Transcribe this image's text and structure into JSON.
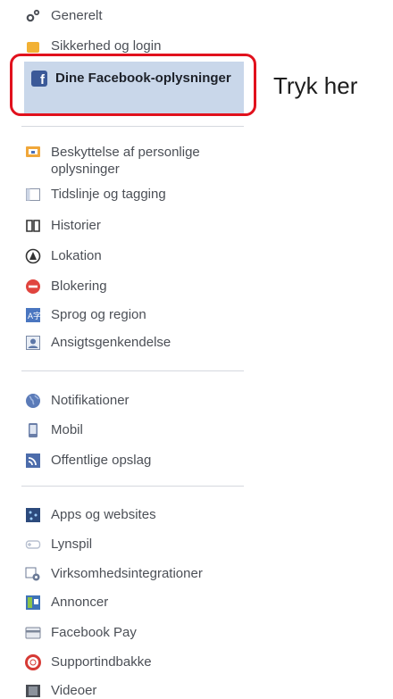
{
  "menu": {
    "top_items": [
      {
        "label": "Generelt",
        "icon": "gear-icon"
      },
      {
        "label": "Sikkerhed og login",
        "icon": "shield-icon"
      }
    ],
    "selected": {
      "label": "Dine Facebook-oplysninger",
      "icon": "facebook-icon"
    },
    "group_privacy": [
      {
        "label": "Beskyttelse af personlige oplysninger",
        "icon": "privacy-lock-icon"
      },
      {
        "label": "Tidslinje og tagging",
        "icon": "timeline-icon"
      },
      {
        "label": "Historier",
        "icon": "book-icon"
      },
      {
        "label": "Lokation",
        "icon": "location-icon"
      },
      {
        "label": "Blokering",
        "icon": "block-icon"
      },
      {
        "label": "Sprog og region",
        "icon": "language-icon"
      },
      {
        "label": "Ansigtsgenkendelse",
        "icon": "face-recognition-icon"
      }
    ],
    "group_notifications": [
      {
        "label": "Notifikationer",
        "icon": "globe-icon"
      },
      {
        "label": "Mobil",
        "icon": "mobile-icon"
      },
      {
        "label": "Offentlige opslag",
        "icon": "rss-icon"
      }
    ],
    "group_apps": [
      {
        "label": "Apps og websites",
        "icon": "apps-icon"
      },
      {
        "label": "Lynspil",
        "icon": "gamepad-icon"
      },
      {
        "label": "Virksomhedsintegrationer",
        "icon": "business-integration-icon"
      },
      {
        "label": "Annoncer",
        "icon": "ads-icon"
      },
      {
        "label": "Facebook Pay",
        "icon": "credit-card-icon"
      },
      {
        "label": "Supportindbakke",
        "icon": "lifebuoy-icon"
      },
      {
        "label": "Videoer",
        "icon": "video-icon"
      }
    ]
  },
  "annotation": {
    "text": "Tryk her",
    "color": "#e1111d"
  },
  "colors": {
    "selected_bg": "#c9d7ea",
    "facebook_blue": "#3b5998",
    "text": "#4b4f56"
  }
}
